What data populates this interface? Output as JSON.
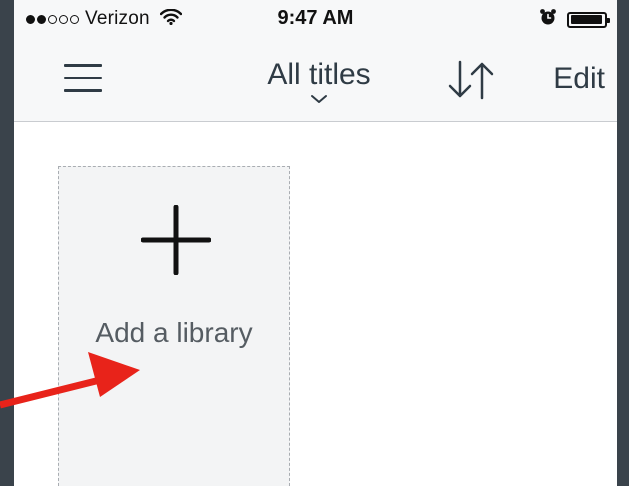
{
  "status_bar": {
    "carrier": "Verizon",
    "signal_bars_filled": 2,
    "signal_bars_total": 5,
    "time": "9:47 AM",
    "icons": [
      "wifi-icon",
      "alarm-icon",
      "battery-icon"
    ],
    "battery_level": 0.95
  },
  "nav": {
    "menu_icon": "hamburger-menu-icon",
    "title": "All titles",
    "title_dropdown_icon": "chevron-down-icon",
    "sort_icon": "sort-arrows-icon",
    "edit_label": "Edit"
  },
  "content": {
    "add_library": {
      "icon": "plus-icon",
      "label": "Add a library"
    }
  },
  "annotation": {
    "arrow_icon": "red-arrow-icon",
    "arrow_color": "#e8231a"
  },
  "colors": {
    "text_dark": "#2f3b45",
    "nav_bg": "#f7f8f9",
    "card_bg": "#f3f4f5",
    "frame": "#3a434b"
  }
}
